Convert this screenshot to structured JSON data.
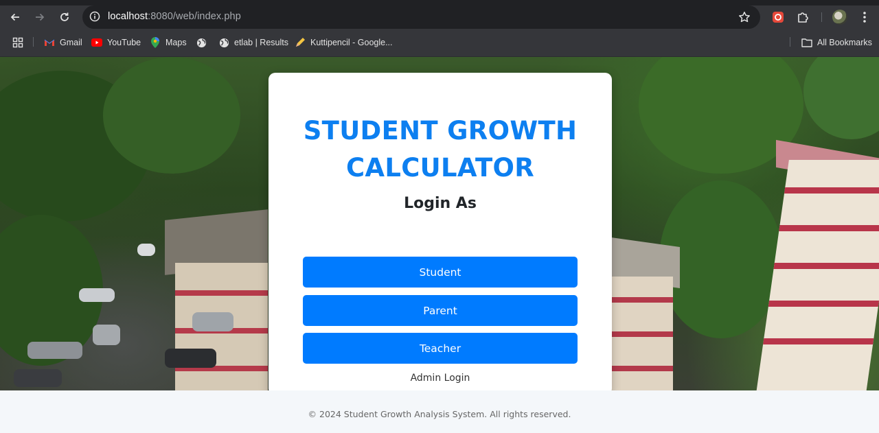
{
  "browser": {
    "url_host": "localhost",
    "url_path": ":8080/web/index.php",
    "bookmarks": [
      {
        "label": "Gmail",
        "icon": "gmail-icon"
      },
      {
        "label": "YouTube",
        "icon": "youtube-icon"
      },
      {
        "label": "Maps",
        "icon": "maps-icon"
      },
      {
        "label": "",
        "icon": "globe-icon"
      },
      {
        "label": "etlab | Results",
        "icon": "globe-icon"
      },
      {
        "label": "Kuttipencil - Google...",
        "icon": "pencil-icon"
      }
    ],
    "all_bookmarks": "All Bookmarks",
    "colors": {
      "chrome_bg": "#35363a",
      "omnibox_bg": "#202124",
      "text": "#e3e3e3"
    }
  },
  "page": {
    "title": "STUDENT GROWTH CALCULATOR",
    "subtitle": "Login As",
    "buttons": {
      "student": "Student",
      "parent": "Parent",
      "teacher": "Teacher"
    },
    "admin_link": "Admin Login",
    "footer": "© 2024 Student Growth Analysis System. All rights reserved.",
    "colors": {
      "title": "#0d7ff0",
      "button": "#007bff",
      "footer_bg": "#f4f7fa"
    }
  }
}
